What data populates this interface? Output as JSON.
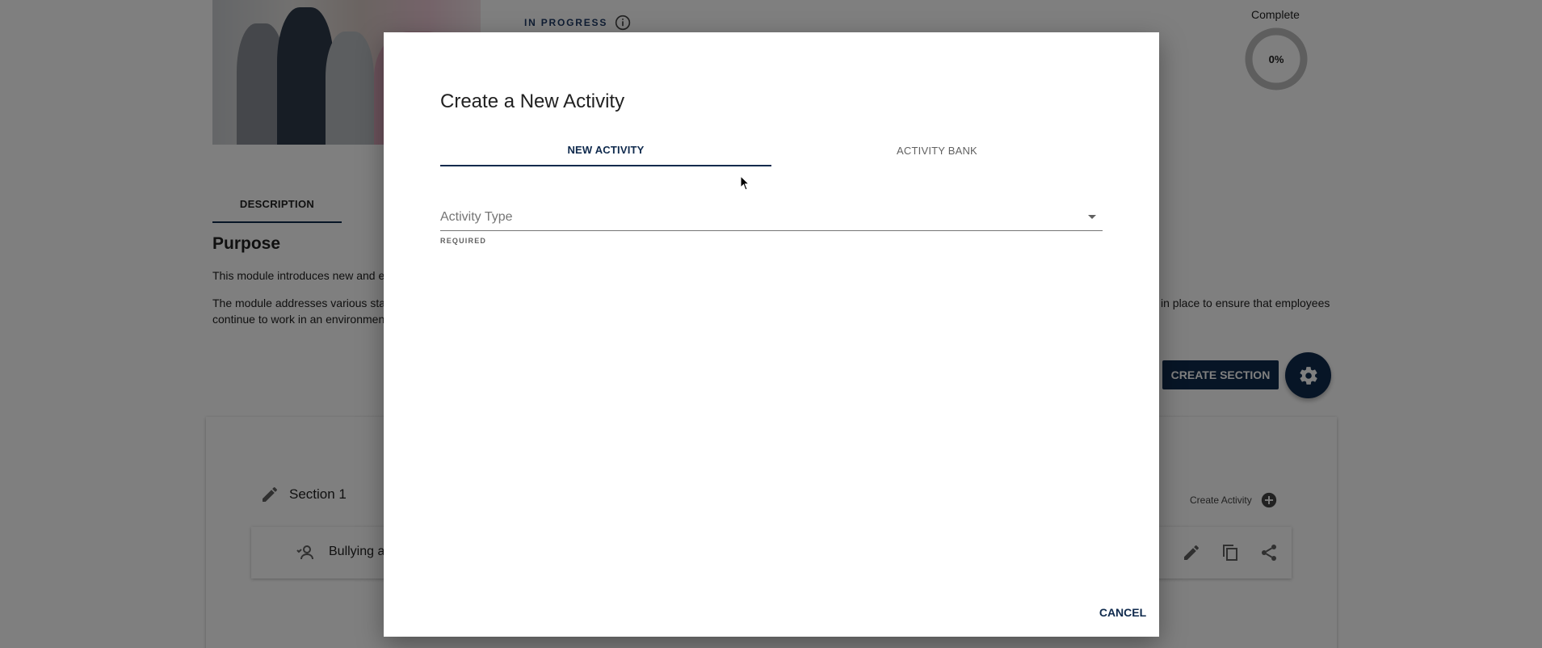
{
  "background": {
    "status": {
      "text": "IN PROGRESS"
    },
    "progress": {
      "label": "Complete",
      "percent_text": "0%",
      "fraction": 0
    },
    "tabs": {
      "description": "DESCRIPTION"
    },
    "purpose": {
      "title": "Purpose",
      "para1": "This module introduces new and e",
      "para2_left": "The module addresses various sta",
      "para2_left_line2": "continue to work in an environmen",
      "para2_right": "in place to ensure that employees"
    },
    "buttons": {
      "create_section": "CREATE SECTION"
    },
    "section": {
      "name": "Section 1",
      "create_activity": "Create Activity",
      "activity_name": "Bullying a"
    }
  },
  "dialog": {
    "title": "Create a New Activity",
    "tabs": [
      {
        "label": "NEW ACTIVITY",
        "active": true
      },
      {
        "label": "ACTIVITY BANK",
        "active": false
      }
    ],
    "activity_type": {
      "placeholder": "Activity Type",
      "helper": "REQUIRED"
    },
    "cancel_label": "CANCEL"
  },
  "colors": {
    "primary": "#0f2a4d",
    "overlay": "rgba(0,0,0,0.5)"
  }
}
